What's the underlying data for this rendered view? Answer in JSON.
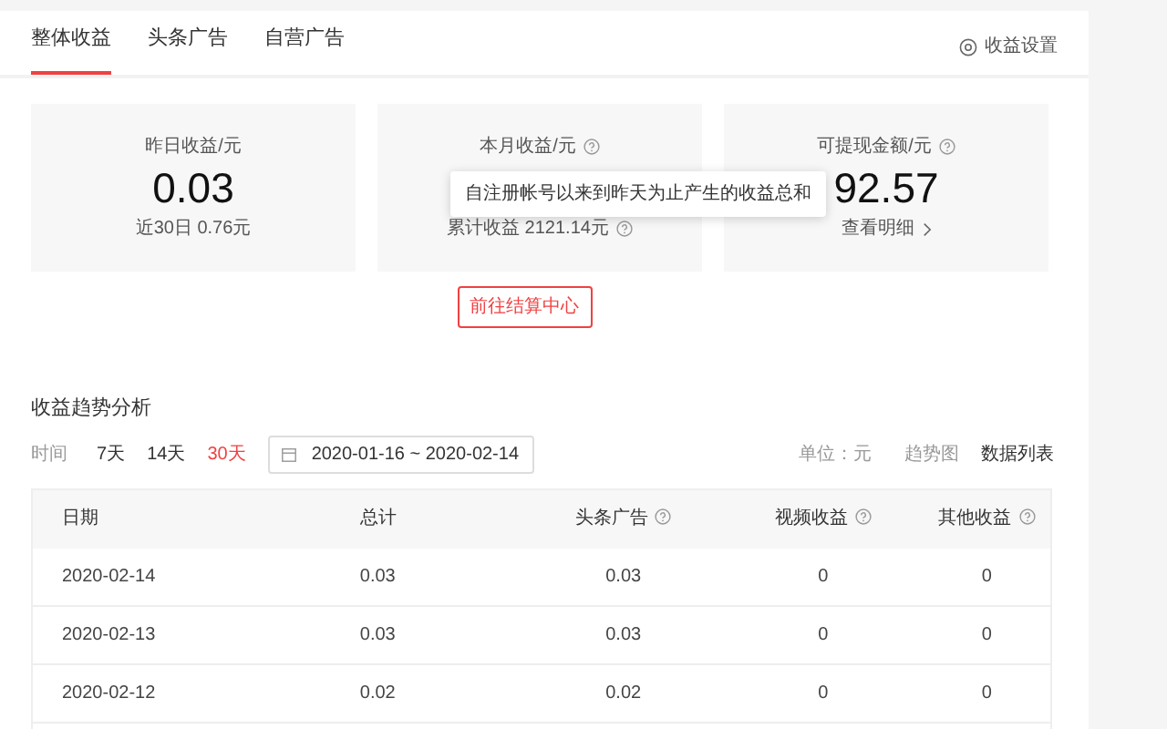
{
  "tabs": [
    {
      "label": "整体收益",
      "selected": true
    },
    {
      "label": "头条广告",
      "selected": false
    },
    {
      "label": "自营广告",
      "selected": false
    }
  ],
  "settings_link": {
    "label": "收益设置"
  },
  "cards": [
    {
      "title": "昨日收益/元",
      "help": false,
      "value": "0.03",
      "footer": "近30日 0.76元",
      "kind": "text"
    },
    {
      "title": "本月收益/元",
      "help": true,
      "tooltip": "自注册帐号以来到昨天为止产生的收益总和",
      "footer": "累计收益 2121.14元",
      "kind": "help"
    },
    {
      "title": "可提现金额/元",
      "help": true,
      "value": "92.57",
      "footer": "查看明细",
      "kind": "link"
    }
  ],
  "settlement_button": "前往结算中心",
  "trend": {
    "title": "收益趋势分析",
    "time_label": "时间",
    "ranges": [
      {
        "label": "7天",
        "selected": false
      },
      {
        "label": "14天",
        "selected": false
      },
      {
        "label": "30天",
        "selected": true
      }
    ],
    "date_start": "2020-01-16",
    "date_separator": "~",
    "date_end": "2020-02-14",
    "unit": "单位：元",
    "views": [
      {
        "label": "趋势图",
        "selected": false
      },
      {
        "label": "数据列表",
        "selected": true
      }
    ]
  },
  "table": {
    "columns": [
      {
        "label": "日期",
        "help": false
      },
      {
        "label": "总计",
        "help": false
      },
      {
        "label": "头条广告",
        "help": true
      },
      {
        "label": "视频收益",
        "help": true
      },
      {
        "label": "其他收益",
        "help": true
      }
    ],
    "rows": [
      [
        "2020-02-14",
        "0.03",
        "0.03",
        "0",
        "0"
      ],
      [
        "2020-02-13",
        "0.03",
        "0.03",
        "0",
        "0"
      ],
      [
        "2020-02-12",
        "0.02",
        "0.02",
        "0",
        "0"
      ]
    ]
  }
}
